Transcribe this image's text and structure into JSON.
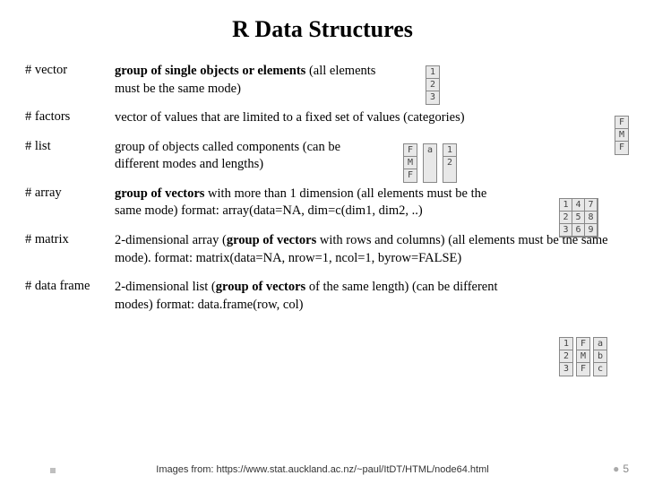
{
  "title": "R Data Structures",
  "items": [
    {
      "label": "# vector",
      "desc_prefix": "",
      "desc_bold": "group of single objects or elements",
      "desc_rest": " (all elements must be the same mode)"
    },
    {
      "label": "# factors",
      "desc_prefix": "vector of values that are limited to a  fixed set of values (categories)",
      "desc_bold": "",
      "desc_rest": ""
    },
    {
      "label": "# list",
      "desc_prefix": "group of objects called components (can be different modes and lengths)",
      "desc_bold": "",
      "desc_rest": ""
    },
    {
      "label": "# array",
      "desc_prefix": "",
      "desc_bold": "group of vectors",
      "desc_rest": " with more than 1 dimension (all elements must be the same mode) format: array(data=NA, dim=c(dim1, dim2, ..)"
    },
    {
      "label": "# matrix",
      "desc_prefix": "2-dimensional array (",
      "desc_bold": "group of vectors",
      "desc_rest": " with rows and columns) (all elements must be the same mode). format: matrix(data=NA, nrow=1, ncol=1, byrow=FALSE)"
    },
    {
      "label": "# data frame",
      "desc_prefix": "2-dimensional list (",
      "desc_bold": "group of vectors",
      "desc_rest": " of the same length) (can be different modes) format: data.frame(row, col)"
    }
  ],
  "diagrams": {
    "vec": [
      "1",
      "2",
      "3"
    ],
    "fac": [
      "F",
      "M",
      "F"
    ],
    "list_c1": [
      "F",
      "M",
      "F"
    ],
    "list_c2": [
      "a"
    ],
    "list_c3": [
      "1",
      "2"
    ],
    "arr": [
      "1",
      "4",
      "7",
      "2",
      "5",
      "8",
      "3",
      "6",
      "9"
    ],
    "df_c1": [
      "1",
      "2",
      "3"
    ],
    "df_c2": [
      "F",
      "M",
      "F"
    ],
    "df_c3": [
      "a",
      "b",
      "c"
    ]
  },
  "footer": "Images from: https://www.stat.auckland.ac.nz/~paul/ItDT/HTML/node64.html",
  "page_num": "5"
}
